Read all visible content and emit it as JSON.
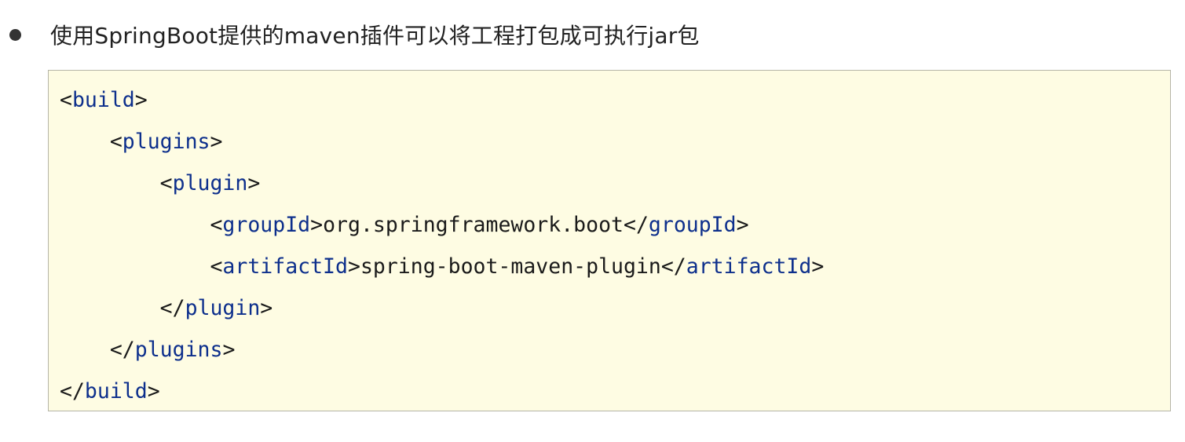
{
  "bullet": {
    "text": "使用SpringBoot提供的maven插件可以将工程打包成可执行jar包"
  },
  "code": {
    "lines": [
      {
        "indent": "",
        "open": "<",
        "tag": "build",
        "close": ">",
        "text": "",
        "end_open": "",
        "end_tag": "",
        "end_close": ""
      },
      {
        "indent": "    ",
        "open": "<",
        "tag": "plugins",
        "close": ">",
        "text": "",
        "end_open": "",
        "end_tag": "",
        "end_close": ""
      },
      {
        "indent": "        ",
        "open": "<",
        "tag": "plugin",
        "close": ">",
        "text": "",
        "end_open": "",
        "end_tag": "",
        "end_close": ""
      },
      {
        "indent": "            ",
        "open": "<",
        "tag": "groupId",
        "close": ">",
        "text": "org.springframework.boot",
        "end_open": "</",
        "end_tag": "groupId",
        "end_close": ">"
      },
      {
        "indent": "            ",
        "open": "<",
        "tag": "artifactId",
        "close": ">",
        "text": "spring-boot-maven-plugin",
        "end_open": "</",
        "end_tag": "artifactId",
        "end_close": ">"
      },
      {
        "indent": "        ",
        "open": "</",
        "tag": "plugin",
        "close": ">",
        "text": "",
        "end_open": "",
        "end_tag": "",
        "end_close": ""
      },
      {
        "indent": "    ",
        "open": "</",
        "tag": "plugins",
        "close": ">",
        "text": "",
        "end_open": "",
        "end_tag": "",
        "end_close": ""
      },
      {
        "indent": "",
        "open": "</",
        "tag": "build",
        "close": ">",
        "text": "",
        "end_open": "",
        "end_tag": "",
        "end_close": ""
      }
    ]
  },
  "colors": {
    "code_background": "#fefce3",
    "code_border": "#b5b5a8",
    "tag_color": "#0d2f8c",
    "text_color": "#1a1a1a",
    "bullet_color": "#333333"
  }
}
